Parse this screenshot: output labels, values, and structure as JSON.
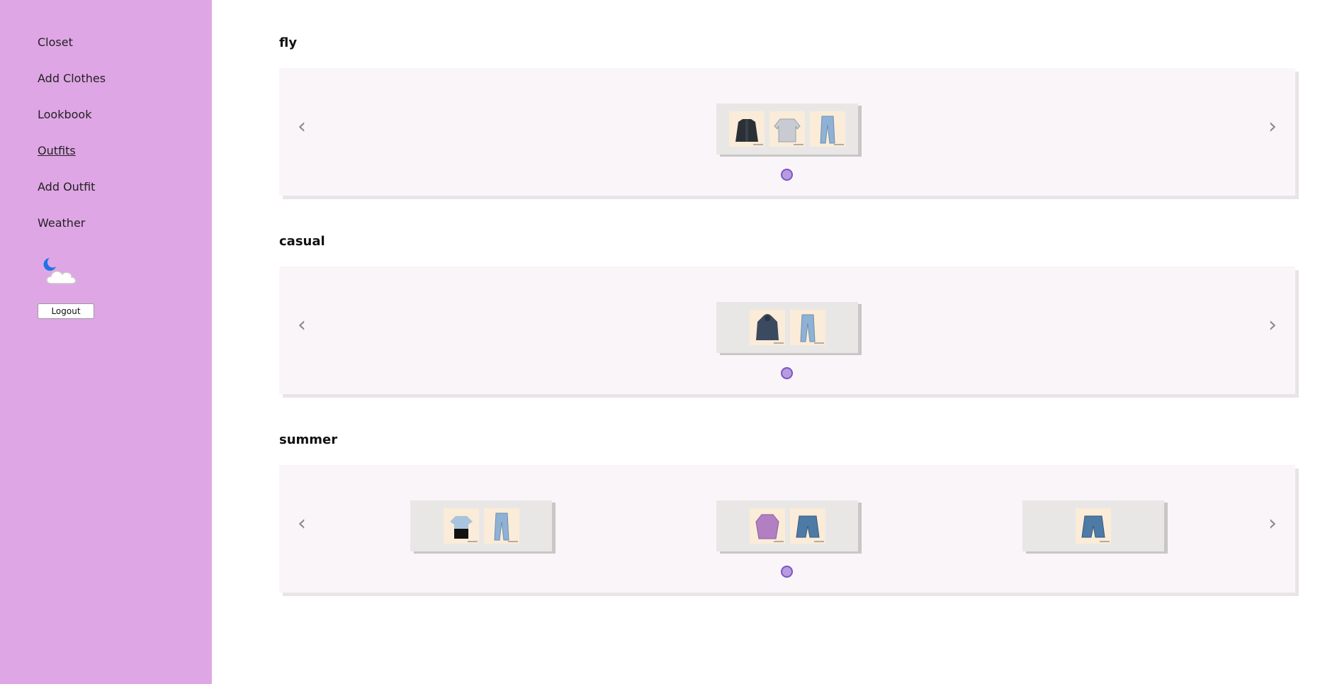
{
  "nav": {
    "items": [
      "Closet",
      "Add Clothes",
      "Lookbook",
      "Outfits",
      "Add Outfit",
      "Weather"
    ],
    "active": "Outfits",
    "weather_icon": "night-cloudy-icon",
    "logout_label": "Logout"
  },
  "colors": {
    "sidebar_bg": "#dfa6e5",
    "carousel_bg": "#faf5f9",
    "card_bg": "#e9e7e6",
    "thumb_bg": "#faecd8",
    "dot_fill": "#b79be0",
    "dot_border": "#7c55c4"
  },
  "carousel_controls": {
    "prev_symbol": "‹",
    "next_symbol": "›"
  },
  "outfits": [
    {
      "name": "fly",
      "cards": [
        {
          "items": [
            "jacket-icon",
            "sweater-icon",
            "jeans-icon"
          ]
        }
      ],
      "dots": 1
    },
    {
      "name": "casual",
      "cards": [
        {
          "items": [
            "hoodie-icon",
            "jeans-icon"
          ]
        }
      ],
      "dots": 1
    },
    {
      "name": "summer",
      "cards": [
        {
          "items": [
            "tshirt-icon",
            "jeans-icon"
          ]
        },
        {
          "items": [
            "shirt-icon",
            "denim-shorts-icon"
          ]
        },
        {
          "items": [
            "denim-shorts-icon"
          ]
        }
      ],
      "dots": 1
    }
  ]
}
